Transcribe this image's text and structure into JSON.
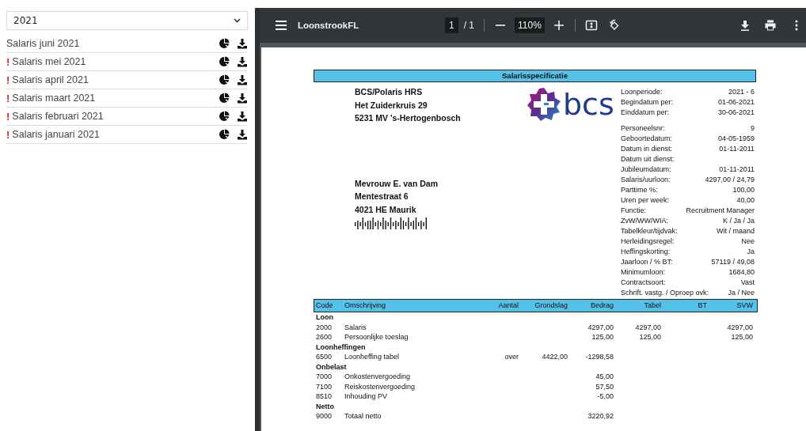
{
  "year_select": {
    "value": "2021"
  },
  "payslips": [
    {
      "label": "Salaris juni 2021",
      "alert": false
    },
    {
      "label": "Salaris mei 2021",
      "alert": true
    },
    {
      "label": "Salaris april 2021",
      "alert": true
    },
    {
      "label": "Salaris maart 2021",
      "alert": true
    },
    {
      "label": "Salaris februari 2021",
      "alert": true
    },
    {
      "label": "Salaris januari 2021",
      "alert": true
    }
  ],
  "alert_mark": "!",
  "viewer": {
    "title": "LoonstrookFL",
    "page": "1",
    "page_count": "/ 1",
    "zoom": "110%"
  },
  "document": {
    "title": "Salarisspecificatie",
    "sender": [
      "BCS/Polaris HRS",
      "Het Zuiderkruis 29",
      "5231 MV  's-Hertogenbosch"
    ],
    "logo_text": "bcs",
    "recipient": [
      "Mevrouw E. van Dam",
      "Mentestraat  6",
      "4021 HE  Maurik"
    ],
    "period": [
      {
        "label": "Loonperiode:",
        "value": "2021 - 6"
      },
      {
        "label": "Begindatum per:",
        "value": "01-06-2021"
      },
      {
        "label": "Einddatum per:",
        "value": "30-06-2021"
      }
    ],
    "details": [
      {
        "label": "Personeelsnr:",
        "value": "9"
      },
      {
        "label": "Geboortedatum:",
        "value": "04-05-1959"
      },
      {
        "label": "Datum in dienst:",
        "value": "01-11-2011"
      },
      {
        "label": "Datum uit dienst:"
      },
      {
        "label": "Jubileumdatum:",
        "value": "01-11-2011"
      },
      {
        "label": "Salaris/uurloon:",
        "value": "4297,00 / 24,79"
      },
      {
        "label": "Parttime %:",
        "value": "100,00"
      },
      {
        "label": "Uren per week:",
        "value": "40,00"
      },
      {
        "label": "Functie:",
        "value": "Recruitment Manager"
      },
      {
        "label": "ZvW/WW/WIA:",
        "value": "K / Ja / Ja"
      },
      {
        "label": "Tabelkleur/tijdvak:",
        "value": "Wit / maand"
      },
      {
        "label": "Herleidingsregel:",
        "value": "Nee"
      },
      {
        "label": "Heffingskorting:",
        "value": "Ja"
      },
      {
        "label": "Jaarloon / % BT:",
        "value": "57119 / 49,08"
      },
      {
        "label": "Minimumloon:",
        "value": "1684,80"
      },
      {
        "label": "Contractsoort:",
        "value": "Vast"
      },
      {
        "label": "Schrift. vastg. / Oproep ovk:",
        "value": "Ja / Nee"
      }
    ],
    "table": {
      "columns": [
        "Code",
        "Omschrijving",
        "Aantal",
        "Grondslag",
        "Bedrag",
        "Tabel",
        "BT",
        "SVW"
      ],
      "rows": [
        {
          "kind": "section",
          "label": "Loon"
        },
        {
          "kind": "line",
          "cells": [
            "2000",
            "Salaris",
            "",
            "",
            "4297,00",
            "4297,00",
            "",
            "4297,00"
          ]
        },
        {
          "kind": "line",
          "cells": [
            "2600",
            "Persoonlijke toeslag",
            "",
            "",
            "125,00",
            "125,00",
            "",
            "125,00"
          ]
        },
        {
          "kind": "section",
          "label": "Loonheffingen"
        },
        {
          "kind": "line",
          "cells": [
            "6500",
            "Loonheffing tabel",
            "over",
            "4422,00",
            "-1298,58",
            "",
            "",
            ""
          ]
        },
        {
          "kind": "section",
          "label": "Onbelast"
        },
        {
          "kind": "line",
          "cells": [
            "7000",
            "Onkostenvergoeding",
            "",
            "",
            "45,00",
            "",
            "",
            ""
          ]
        },
        {
          "kind": "line",
          "cells": [
            "7100",
            "Reiskostenvergoeding",
            "",
            "",
            "57,50",
            "",
            "",
            ""
          ]
        },
        {
          "kind": "line",
          "cells": [
            "8510",
            "Inhouding PV",
            "",
            "",
            "-5,00",
            "",
            "",
            ""
          ]
        },
        {
          "kind": "section",
          "label": "Netto"
        },
        {
          "kind": "line",
          "cells": [
            "9000",
            "Totaal netto",
            "",
            "",
            "3220,92",
            "",
            "",
            ""
          ]
        }
      ]
    }
  }
}
